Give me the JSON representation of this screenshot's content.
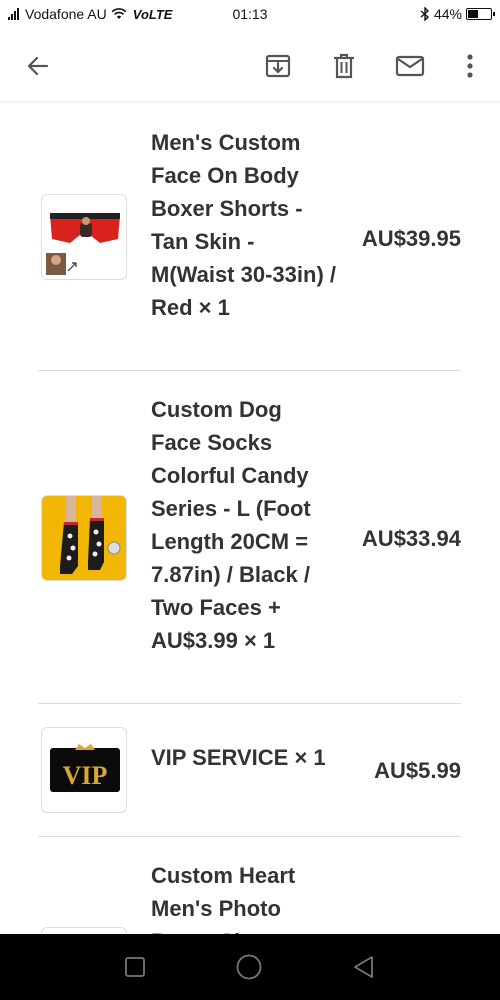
{
  "status_bar": {
    "carrier": "Vodafone AU",
    "network": "VoLTE",
    "time": "01:13",
    "battery": "44%",
    "battery_level": 0.44
  },
  "toolbar": {
    "icons": [
      "back-icon",
      "archive-icon",
      "delete-icon",
      "mail-icon",
      "more-icon"
    ]
  },
  "order_items": [
    {
      "title": "Men's Custom Face On Body Boxer Shorts - Tan Skin - M(Waist 30-33in) / Red × 1",
      "price": "AU$39.95"
    },
    {
      "title": "Custom Dog Face Socks Colorful Candy Series - L (Foot Length 20CM = 7.87in) / Black / Two Faces + AU$3.99 × 1",
      "price": "AU$33.94"
    },
    {
      "title": "VIP SERVICE × 1",
      "price": "AU$5.99",
      "badge_text": "VIP"
    },
    {
      "title": "Custom Heart Men's Photo Boxer Shorts",
      "price": ""
    }
  ],
  "colors": {
    "text": "#333333",
    "divider": "#dcdcdc",
    "boxer_red": "#d9221e",
    "sock_yellow": "#f2b705",
    "vip_gold": "#d6a73a"
  }
}
